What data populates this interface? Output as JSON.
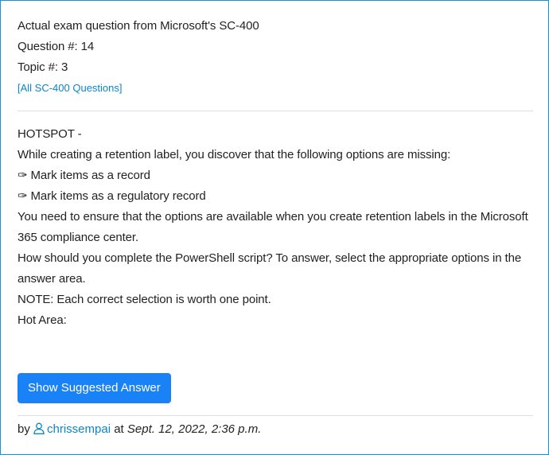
{
  "header": {
    "title": "Actual exam question from Microsoft's SC-400",
    "question_number": "Question #: 14",
    "topic": "Topic #: 3",
    "all_questions_link": "[All SC-400 Questions]"
  },
  "question": {
    "type_label": "HOTSPOT -",
    "intro": "While creating a retention label, you discover that the following options are missing:",
    "options": [
      "✑ Mark items as a record",
      "✑ Mark items as a regulatory record"
    ],
    "requirement": "You need to ensure that the options are available when you create retention labels in the Microsoft 365 compliance center.",
    "instruction": "How should you complete the PowerShell script? To answer, select the appropriate options in the answer area.",
    "note": "NOTE: Each correct selection is worth one point.",
    "hot_area_label": "Hot Area:"
  },
  "actions": {
    "show_answer_label": "Show Suggested Answer"
  },
  "footer": {
    "by_label": "by",
    "username": "chrissempai",
    "at_label": "at",
    "date": "Sept. 12, 2022, 2:36 p.m."
  },
  "icons": {
    "user": "user-icon"
  },
  "colors": {
    "border": "#1e8fd3",
    "link": "#0a86c9",
    "button": "#1a82f7"
  }
}
